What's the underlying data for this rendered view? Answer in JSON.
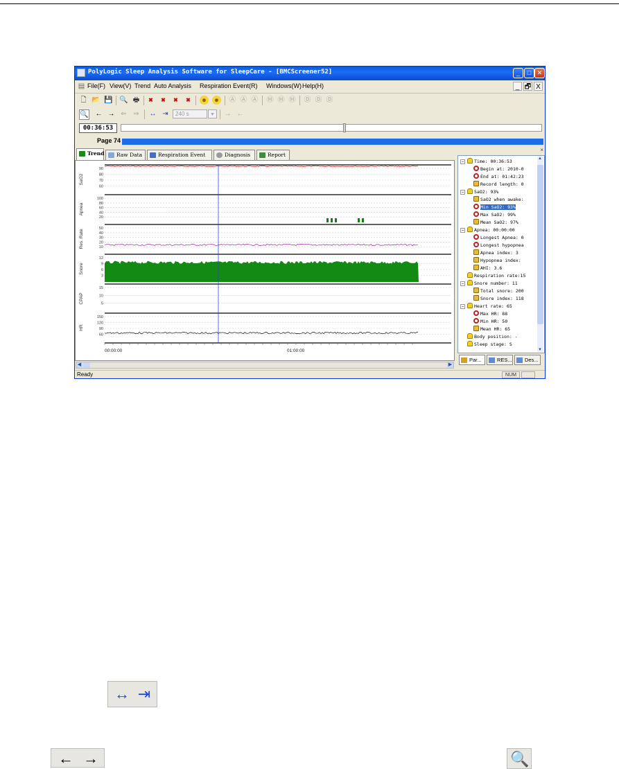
{
  "window": {
    "title": "PolyLogic Sleep Analysis Software for SleepCare - [BMCScreener52]",
    "controls": [
      "_",
      "□",
      "✕"
    ]
  },
  "menubar": {
    "items": [
      "File(F)",
      "View(V)",
      "Trend",
      "Auto Analysis",
      "Respiration Event(R)",
      "Windows(W)",
      "Help(H)"
    ],
    "mdi": [
      "_",
      "🗗",
      "X"
    ]
  },
  "toolbar2": {
    "zoom_value": "240 s"
  },
  "timebar": {
    "current_time": "00:36:53",
    "scroll_fraction": 0.53
  },
  "pagebar": {
    "label": "Page 74"
  },
  "tabs": [
    "Trend",
    "Raw Data",
    "Respiration Event",
    "Diagnosis",
    "Report"
  ],
  "chart_data": {
    "type": "line",
    "x_range": [
      "00:00:00",
      "01:42:23"
    ],
    "x_ticks": [
      "00:00:00",
      "01:00:00"
    ],
    "cursor_time": "00:36:53",
    "panels": [
      {
        "name": "SaO2",
        "ticks": [
          "90",
          "80",
          "70",
          "60"
        ],
        "style": "line",
        "color": "#c01818",
        "level": 0.95
      },
      {
        "name": "Apnea",
        "ticks": [
          "100",
          "80",
          "60",
          "40",
          "20"
        ],
        "style": "bars",
        "color": "#1a7a1a"
      },
      {
        "name": "Res. Rate",
        "ticks": [
          "50",
          "40",
          "30",
          "20",
          "10"
        ],
        "style": "line",
        "color": "#a020a0",
        "level": 0.3
      },
      {
        "name": "Snore",
        "ticks": [
          "12",
          "9",
          "6",
          "3"
        ],
        "style": "fill",
        "color": "#138a13",
        "level": 0.72
      },
      {
        "name": "CPAP",
        "ticks": [
          "15",
          "10",
          "5"
        ],
        "style": "none",
        "color": "#000000"
      },
      {
        "name": "HR",
        "ticks": [
          "150",
          "120",
          "90",
          "60"
        ],
        "style": "line",
        "color": "#111111",
        "level": 0.32
      }
    ]
  },
  "sidebar": {
    "close": "×",
    "tree": [
      {
        "level": 0,
        "expander": "−",
        "icon": "bell",
        "text": "Time: 00:36:53"
      },
      {
        "level": 1,
        "icon": "clock",
        "text": "Begin at: 2010-0"
      },
      {
        "level": 1,
        "icon": "clock",
        "text": "End at: 01:42:23"
      },
      {
        "level": 1,
        "icon": "chart",
        "text": "Record length: 0"
      },
      {
        "level": 0,
        "expander": "−",
        "icon": "bell",
        "text": "SaO2: 93%"
      },
      {
        "level": 1,
        "icon": "chart",
        "text": "SaO2 when awake:"
      },
      {
        "level": 1,
        "icon": "clock",
        "text": "Min SaO2: 93%",
        "selected": true
      },
      {
        "level": 1,
        "icon": "clock",
        "text": "Max SaO2: 99%"
      },
      {
        "level": 1,
        "icon": "chart",
        "text": "Mean SaO2: 97%"
      },
      {
        "level": 0,
        "expander": "−",
        "icon": "bell",
        "text": "Apnea: 00:00:00"
      },
      {
        "level": 1,
        "icon": "clock",
        "text": "Longest Apnea: 0"
      },
      {
        "level": 1,
        "icon": "clock",
        "text": "Longest hypopnea"
      },
      {
        "level": 1,
        "icon": "chart",
        "text": "Apnea index:   3"
      },
      {
        "level": 1,
        "icon": "chart",
        "text": "Hypopnea index:"
      },
      {
        "level": 1,
        "icon": "chart",
        "text": "AHI:   3.6"
      },
      {
        "level": 0,
        "expander": "",
        "icon": "bell",
        "text": "Respiration rate:15"
      },
      {
        "level": 0,
        "expander": "−",
        "icon": "bell",
        "text": "Snore number: 11"
      },
      {
        "level": 1,
        "icon": "chart",
        "text": "Total snore: 200"
      },
      {
        "level": 1,
        "icon": "chart",
        "text": "Snore index: 118"
      },
      {
        "level": 0,
        "expander": "−",
        "icon": "bell",
        "text": "Heart rate: 65"
      },
      {
        "level": 1,
        "icon": "clock",
        "text": "Max HR: 88"
      },
      {
        "level": 1,
        "icon": "clock",
        "text": "Min HR: 50"
      },
      {
        "level": 1,
        "icon": "chart",
        "text": "Mean HR: 65"
      },
      {
        "level": 0,
        "expander": "",
        "icon": "bell",
        "text": "Body position: -"
      },
      {
        "level": 0,
        "expander": "",
        "icon": "bell",
        "text": "Sleep stage: S"
      }
    ],
    "tabs": [
      "Par...",
      "RES...",
      "Des..."
    ]
  },
  "statusbar": {
    "text": "Ready",
    "num": "NUM"
  }
}
